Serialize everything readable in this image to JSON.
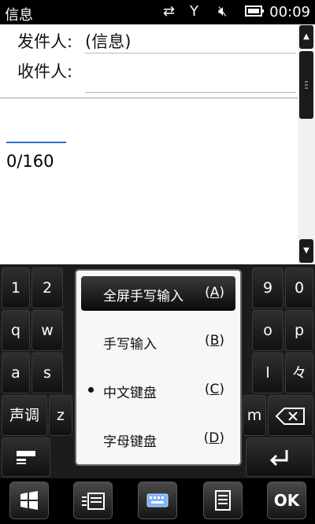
{
  "status_bar": {
    "title": "信息",
    "time": "00:09",
    "icons": [
      "data-transfer-icon",
      "signal-icon",
      "speaker-muted-icon",
      "battery-icon"
    ]
  },
  "compose": {
    "from_label": "发件人:",
    "from_value": "(信息)",
    "to_label": "收件人:",
    "to_value": "",
    "char_counter": "0/160"
  },
  "keyboard": {
    "row1": [
      "1",
      "2",
      "9",
      "0"
    ],
    "row2": [
      "q",
      "w",
      "o",
      "p"
    ],
    "row3": [
      "a",
      "s",
      "l",
      "々"
    ],
    "row4": [
      "声调",
      "z",
      "m"
    ],
    "backspace_icon": "backspace-icon",
    "enter_icon": "enter-icon",
    "mode_icon": "keyboard-mode-icon"
  },
  "input_menu": {
    "items": [
      {
        "label": "全屏手写输入",
        "shortcut_prefix": "(",
        "shortcut_key": "A",
        "shortcut_suffix": ")",
        "selected": true,
        "checked": false
      },
      {
        "label": "手写输入",
        "shortcut_prefix": "(",
        "shortcut_key": "B",
        "shortcut_suffix": ")",
        "selected": false,
        "checked": false
      },
      {
        "label": "中文键盘",
        "shortcut_prefix": "(",
        "shortcut_key": "C",
        "shortcut_suffix": ")",
        "selected": false,
        "checked": true
      },
      {
        "label": "字母键盘",
        "shortcut_prefix": "(",
        "shortcut_key": "D",
        "shortcut_suffix": ")",
        "selected": false,
        "checked": false
      }
    ]
  },
  "bottom_bar": {
    "ok_label": "OK",
    "buttons": [
      "windows-start-icon",
      "message-menu-icon",
      "keyboard-icon",
      "notes-icon"
    ]
  },
  "colors": {
    "accent_blue": "#2a6fd6",
    "keyboard_bg": "#1c1c1c"
  }
}
